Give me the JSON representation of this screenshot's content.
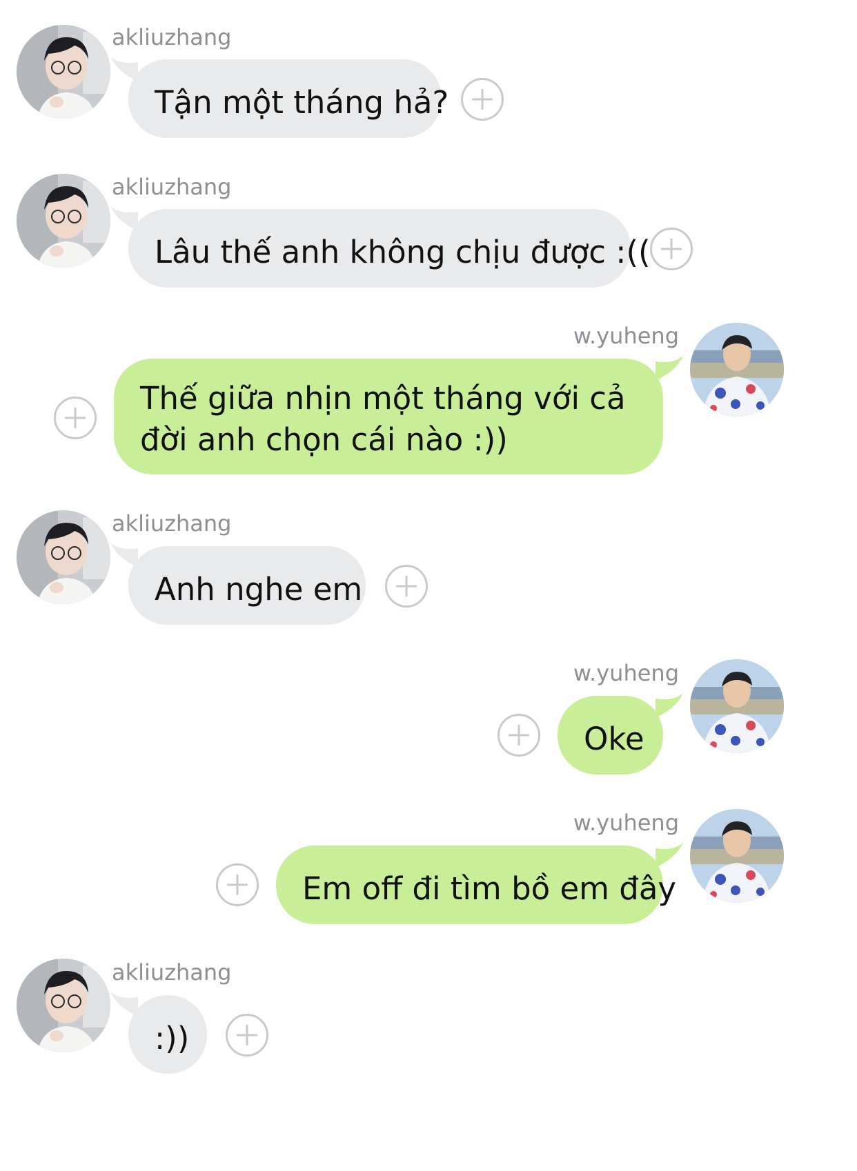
{
  "messages": [
    {
      "sender": "akliuzhang",
      "side": "left",
      "text": "Tận một tháng hả?"
    },
    {
      "sender": "akliuzhang",
      "side": "left",
      "text": "Lâu thế anh không chịu được :(("
    },
    {
      "sender": "w.yuheng",
      "side": "right",
      "text": "Thế giữa nhịn một tháng với cả đời anh chọn cái nào :))"
    },
    {
      "sender": "akliuzhang",
      "side": "left",
      "text": "Anh nghe em"
    },
    {
      "sender": "w.yuheng",
      "side": "right",
      "text": "Oke"
    },
    {
      "sender": "w.yuheng",
      "side": "right",
      "text": "Em off đi tìm bồ em đây"
    },
    {
      "sender": "akliuzhang",
      "side": "left",
      "text": ":))"
    }
  ],
  "icons": {
    "add_reaction": "plus-circle-icon",
    "avatar_left": "avatar-akliuzhang",
    "avatar_right": "avatar-w-yuheng"
  },
  "colors": {
    "received_bubble": "#e9eaec",
    "sent_bubble": "#c8ef98",
    "username_text": "#8e8e93",
    "plus_icon": "#c9c9ce"
  }
}
